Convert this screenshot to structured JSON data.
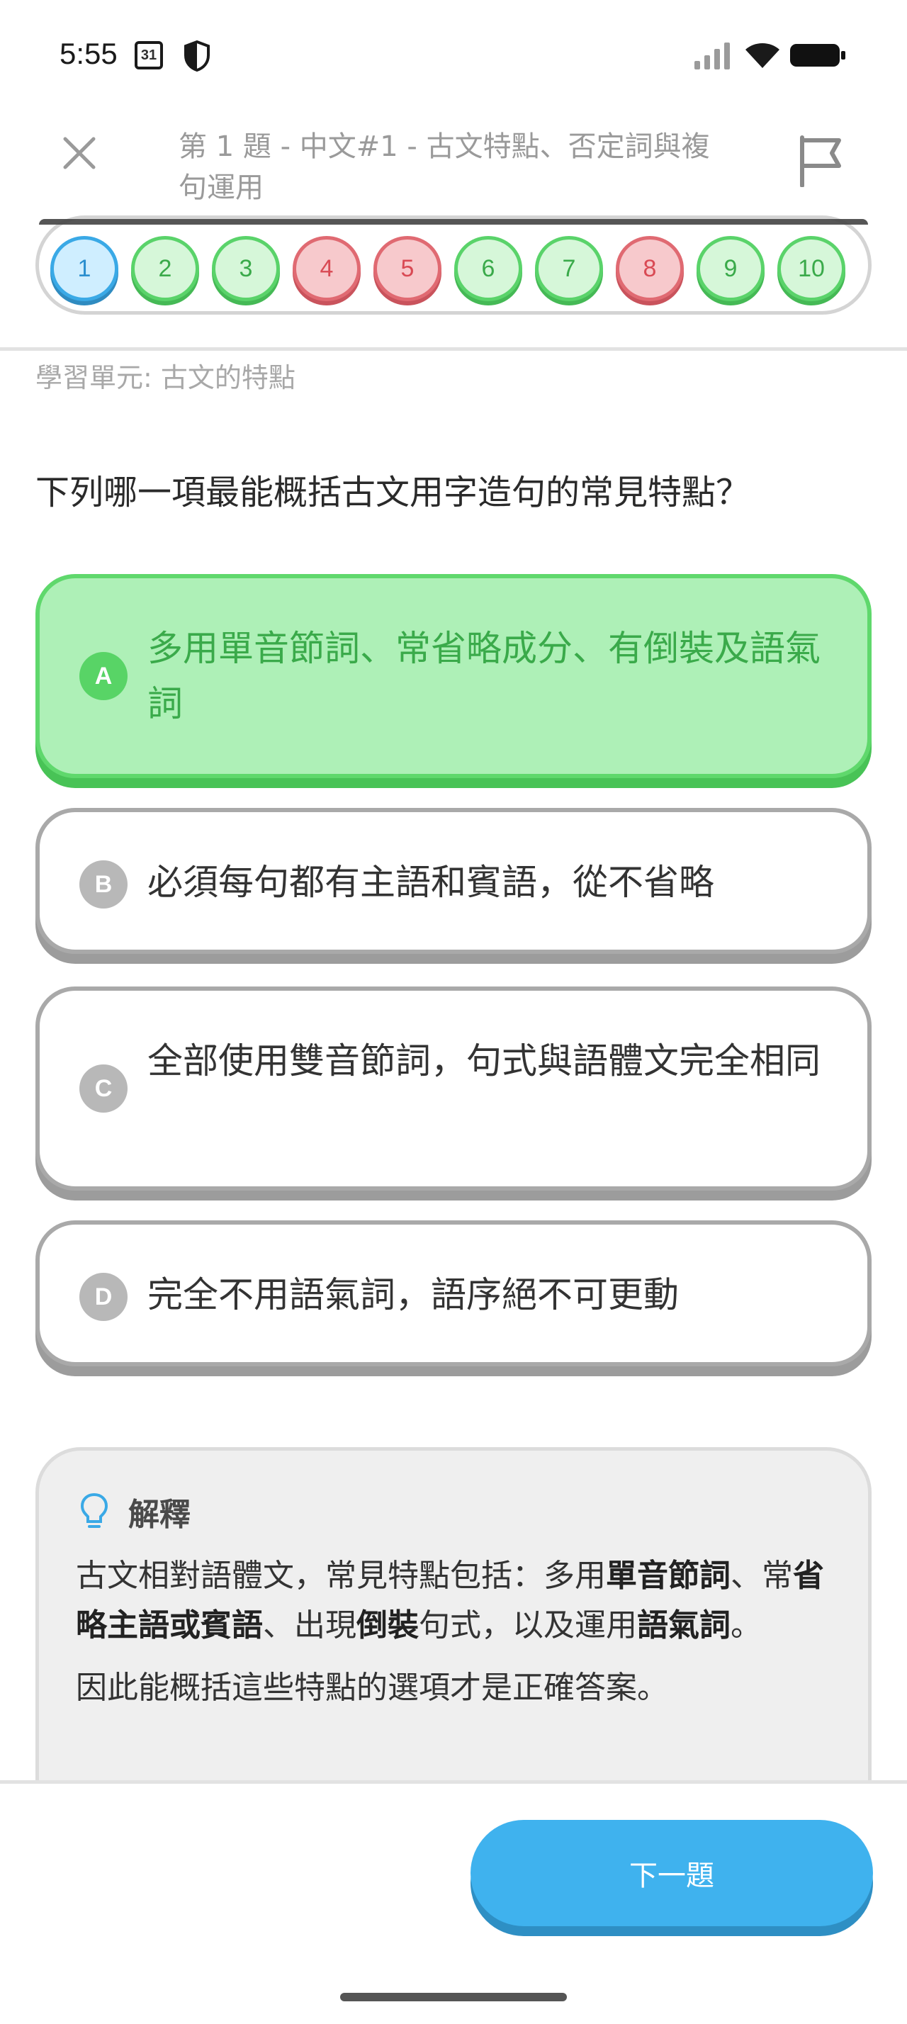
{
  "status_bar": {
    "time": "5:55",
    "calendar_day": "31"
  },
  "header": {
    "title": "第 1 題 - 中文#1 - 古文特點、否定詞與複句運用"
  },
  "progress": {
    "questions": [
      {
        "number": "1",
        "state": "current"
      },
      {
        "number": "2",
        "state": "correct"
      },
      {
        "number": "3",
        "state": "correct"
      },
      {
        "number": "4",
        "state": "wrong"
      },
      {
        "number": "5",
        "state": "wrong"
      },
      {
        "number": "6",
        "state": "correct"
      },
      {
        "number": "7",
        "state": "correct"
      },
      {
        "number": "8",
        "state": "wrong"
      },
      {
        "number": "9",
        "state": "correct"
      },
      {
        "number": "10",
        "state": "correct"
      }
    ]
  },
  "unit_label": "學習單元: 古文的特點",
  "question": "下列哪一項最能概括古文用字造句的常見特點？",
  "options": [
    {
      "letter": "A",
      "text": "多用單音節詞、常省略成分、有倒裝及語氣詞",
      "state": "selected"
    },
    {
      "letter": "B",
      "text": "必須每句都有主語和賓語，從不省略",
      "state": "normal"
    },
    {
      "letter": "C",
      "text": "全部使用雙音節詞，句式與語體文完全相同",
      "state": "normal"
    },
    {
      "letter": "D",
      "text": "完全不用語氣詞，語序絕不可更動",
      "state": "normal"
    }
  ],
  "explanation": {
    "title": "解釋",
    "p1_parts": [
      "古文相對語體文，常見特點包括：多用",
      "單音節詞",
      "、常",
      "省略主語或賓語",
      "、出現",
      "倒裝",
      "句式，以及運用",
      "語氣詞",
      "。"
    ],
    "p2": "因此能概括這些特點的選項才是正確答案。"
  },
  "footer": {
    "next_label": "下一題"
  },
  "colors": {
    "accent_blue": "#3fb2ee",
    "correct_green": "#5fd86c",
    "wrong_red": "#e06a72"
  }
}
